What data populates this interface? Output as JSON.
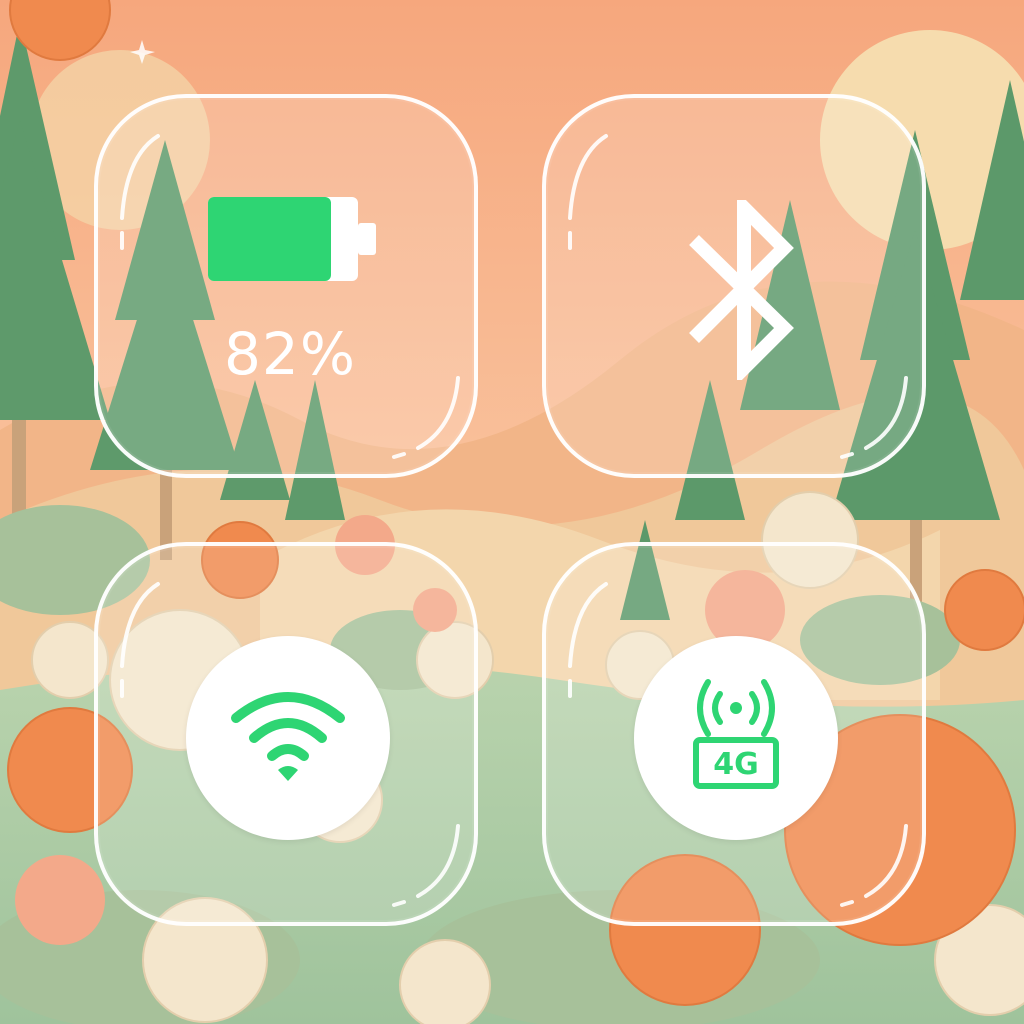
{
  "battery": {
    "level_text": "82%",
    "level_fraction": 0.82,
    "color": "#2ed573",
    "icon": "battery-icon"
  },
  "bluetooth": {
    "icon": "bluetooth-icon"
  },
  "wifi": {
    "icon": "wifi-icon",
    "color": "#2ed573"
  },
  "cellular": {
    "icon": "cellular-4g-icon",
    "badge_text": "4G",
    "color": "#2ed573"
  },
  "colors": {
    "tile_border": "#ffffff",
    "accent": "#2ed573",
    "sky": "#f7b489",
    "meadow": "#a8c9a4"
  }
}
